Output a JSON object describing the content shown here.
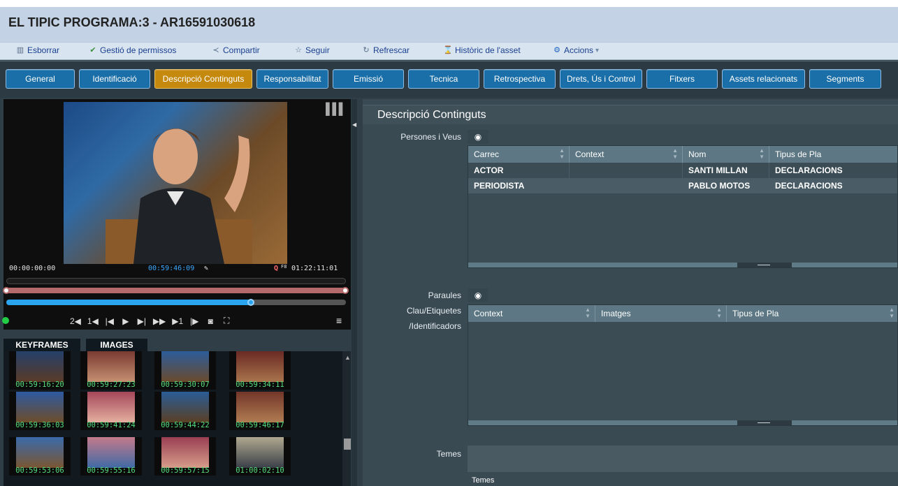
{
  "window": {
    "title": "EL TIPIC PROGRAMA:3 - AR16591030618"
  },
  "toolbar": {
    "items": [
      {
        "label": "Esborrar",
        "icon": "trash-icon"
      },
      {
        "label": "Gestió de permissos",
        "icon": "permissions-icon"
      },
      {
        "label": "Compartir",
        "icon": "share-icon"
      },
      {
        "label": "Seguir",
        "icon": "star-icon"
      },
      {
        "label": "Refrescar",
        "icon": "refresh-icon"
      },
      {
        "label": "Històric de l'asset",
        "icon": "history-icon"
      },
      {
        "label": "Accions",
        "icon": "actions-icon"
      }
    ]
  },
  "tabs": [
    {
      "label": "General"
    },
    {
      "label": "Identificació"
    },
    {
      "label": "Descripció Continguts",
      "active": true
    },
    {
      "label": "Responsabilitat"
    },
    {
      "label": "Emissió"
    },
    {
      "label": "Tecnica"
    },
    {
      "label": "Retrospectiva"
    },
    {
      "label": "Drets, Ús i Control"
    },
    {
      "label": "Fitxers"
    },
    {
      "label": "Assets relacionats"
    },
    {
      "label": "Segments"
    }
  ],
  "player": {
    "tc_start": "00:00:00:00",
    "tc_current": "00:59:46:09",
    "tc_end": "01:22:11:01",
    "tc_end_prefix": "F8",
    "progress_fraction": 0.72,
    "controls": [
      "2◀",
      "1◀",
      "|◀",
      "▶",
      "▶|",
      "▶▶",
      "▶1",
      "|▶"
    ]
  },
  "media_tabs": {
    "keyframes": "KEYFRAMES",
    "images": "IMAGES"
  },
  "thumbnails": [
    "00:59:16:20",
    "00:59:27:23",
    "00:59:30:07",
    "00:59:34:11",
    "00:59:36:03",
    "00:59:41:24",
    "00:59:44:22",
    "00:59:46:17",
    "00:59:53:06",
    "00:59:55:16",
    "00:59:57:15",
    "01:00:02:10"
  ],
  "section": {
    "title": "Descripció Continguts",
    "persones": {
      "label": "Persones i Veus",
      "columns": [
        "Carrec",
        "Context",
        "Nom",
        "Tipus de Pla"
      ],
      "rows": [
        [
          "ACTOR",
          "",
          "SANTI MILLAN",
          "DECLARACIONS"
        ],
        [
          "PERIODISTA",
          "",
          "PABLO MOTOS",
          "DECLARACIONS"
        ]
      ]
    },
    "paraules": {
      "label_line1": "Paraules",
      "label_line2": "Clau/Etiquetes",
      "label_line3": "/Identificadors",
      "columns": [
        "Context",
        "Imatges",
        "Tipus de Pla"
      ]
    },
    "temes": {
      "label": "Temes",
      "sublabel": "Temes"
    }
  },
  "colors": {
    "active_tab": "#c5890e",
    "tab": "#1b6fa8",
    "timecode_green": "#57e07c",
    "timecode_blue": "#3aa8ff"
  }
}
